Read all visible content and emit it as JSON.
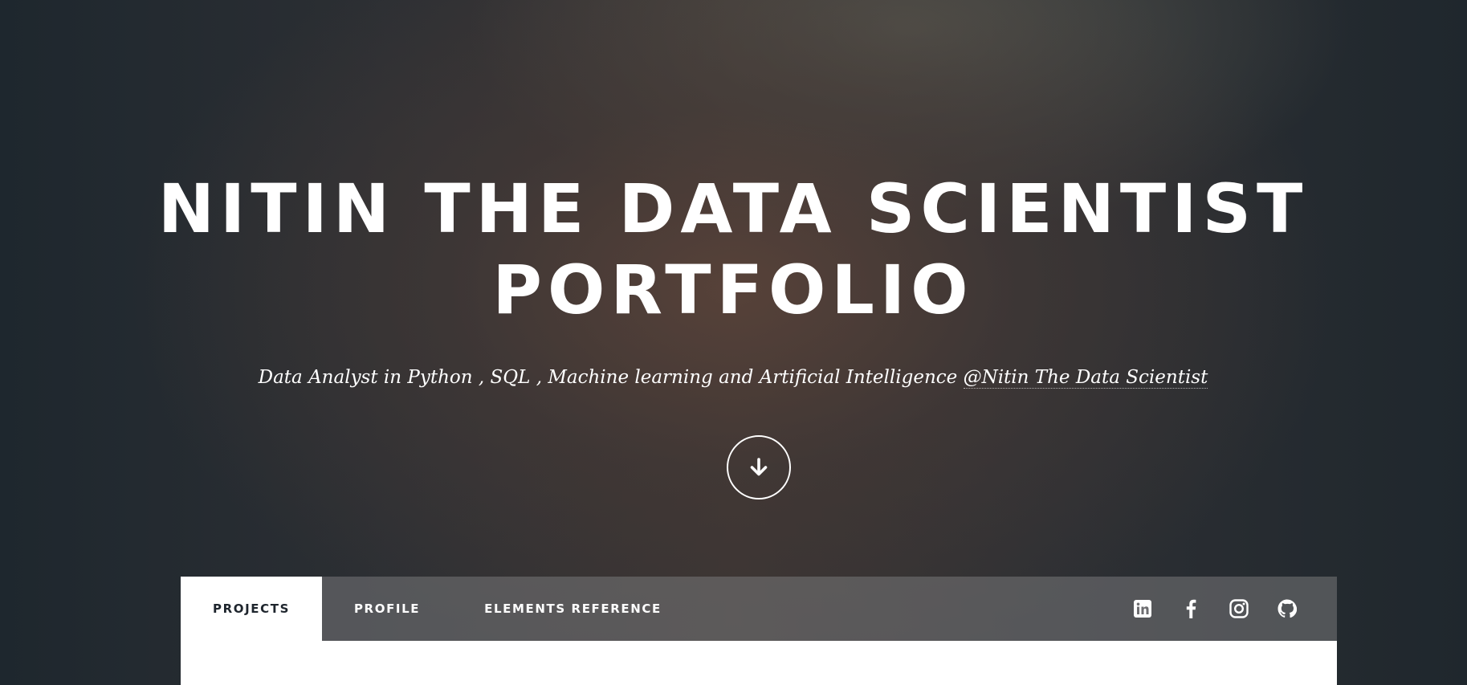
{
  "hero": {
    "title_line1": "NITIN THE DATA SCIENTIST",
    "title_line2": "PORTFOLIO",
    "subtitle_text": "Data Analyst in Python , SQL , Machine learning and Artificial Intelligence ",
    "subtitle_link": "@Nitin The Data Scientist",
    "scroll_icon": "arrow-down-icon"
  },
  "nav": {
    "tabs": [
      {
        "label": "PROJECTS",
        "active": true
      },
      {
        "label": "PROFILE",
        "active": false
      },
      {
        "label": "ELEMENTS REFERENCE",
        "active": false
      }
    ],
    "socials": [
      "linkedin-icon",
      "facebook-icon",
      "instagram-icon",
      "github-icon"
    ]
  },
  "colors": {
    "text": "#ffffff",
    "tab_active_bg": "#ffffff",
    "tab_active_text": "#1e252d",
    "navbar_bg": "#6e6e70"
  }
}
